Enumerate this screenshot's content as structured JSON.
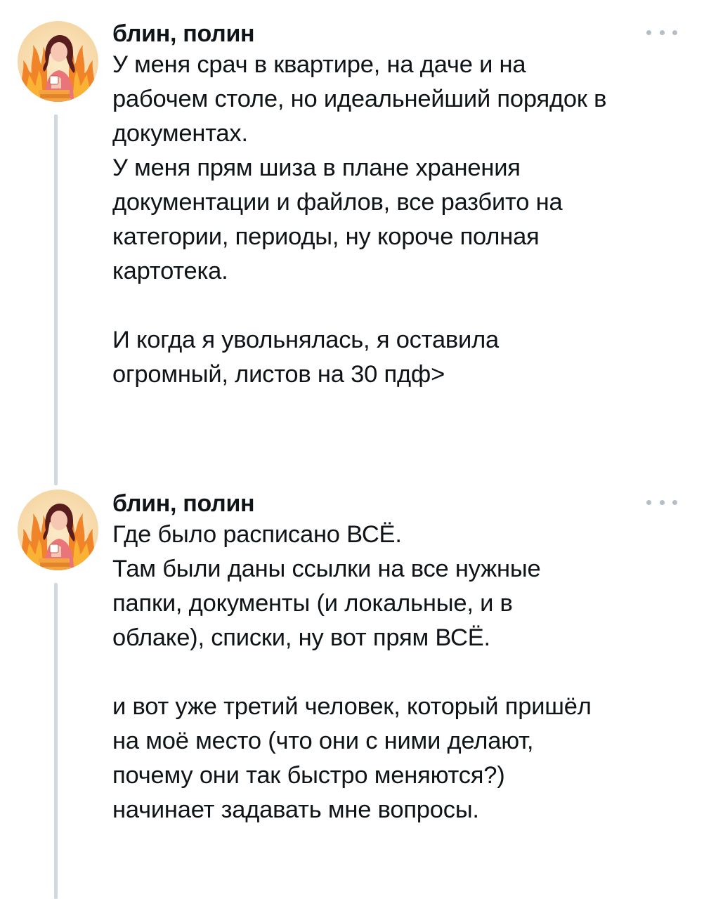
{
  "thread": [
    {
      "author": "блин, полин",
      "avatar_icon": "avatar-icon",
      "more_icon": "more-horizontal-icon",
      "paragraphs": [
        "У меня срач в квартире, на даче и на\nрабочем столе, но идеальнейший порядок в\nдокументах.\nУ меня прям шиза в плане хранения\nдокументации и файлов, все разбито на\nкатегории, периоды, ну короче полная\nкартотека.",
        "И когда я увольнялась, я оставила\nогромный, листов на 30 пдф>"
      ]
    },
    {
      "author": "блин, полин",
      "avatar_icon": "avatar-icon",
      "more_icon": "more-horizontal-icon",
      "paragraphs": [
        "Где было расписано ВСЁ.\nТам были даны ссылки на все нужные\nпапки, документы (и локальные, и в\nоблаке), списки, ну вот прям ВСЁ.",
        "и вот уже третий человек, который пришёл\nна моё место (что они с ними делают,\nпочему они так быстро меняются?)\nначинает задавать мне вопросы."
      ]
    }
  ],
  "colors": {
    "text": "#0f1419",
    "thread_line": "#cfd9de",
    "more_dots": "#b5bec5",
    "avatar_bg": "#f8dcae",
    "flame": "#f07a1a"
  }
}
